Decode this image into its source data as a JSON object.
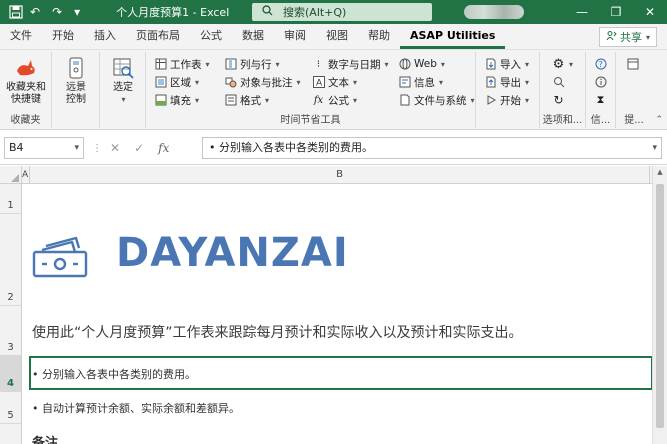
{
  "titlebar": {
    "title": "个人月度预算1  -  Excel",
    "search_placeholder": "搜索(Alt+Q)",
    "undo": "↶",
    "redo": "↷",
    "more": "▾",
    "minimize": "—",
    "restore": "❐",
    "close": "✕"
  },
  "tabs": [
    "文件",
    "开始",
    "插入",
    "页面布局",
    "公式",
    "数据",
    "审阅",
    "视图",
    "帮助",
    "ASAP Utilities"
  ],
  "active_tab": "ASAP Utilities",
  "share_label": "共享",
  "ribbon": {
    "favorites": {
      "btn1": "收藏夹和",
      "btn2": "快捷键",
      "label": "收藏夹"
    },
    "remote": {
      "btn1": "远景",
      "btn2": "控制"
    },
    "select": {
      "btn": "选定"
    },
    "col1": [
      "工作表",
      "区域",
      "填充"
    ],
    "col2": [
      "列与行",
      "对象与批注",
      "格式"
    ],
    "col3": [
      "数字与日期",
      "文本",
      "公式"
    ],
    "col4": [
      "Web",
      "信息",
      "文件与系统"
    ],
    "col5": [
      "导入",
      "导出",
      "开始"
    ],
    "time_label": "时间节省工具",
    "options_label": "选项和...",
    "info_label": "信...",
    "extra_label": "提..."
  },
  "formula_bar": {
    "name_box": "B4",
    "formula": "• 分别输入各表中各类别的费用。"
  },
  "columns": {
    "a": "A",
    "b": "B"
  },
  "rows": [
    "1",
    "2",
    "3",
    "4",
    "5"
  ],
  "sheet": {
    "logo_text": "DAYANZAI",
    "intro": "使用此“个人月度预算”工作表来跟踪每月预计和实际收入以及预计和实际支出。",
    "line4": "• 分别输入各表中各类别的费用。",
    "line5": "• 自动计算预计余额、实际余额和差额异。",
    "note_head": "备注"
  },
  "colors": {
    "excel_green": "#217346",
    "logo_blue": "#4a76b3"
  }
}
